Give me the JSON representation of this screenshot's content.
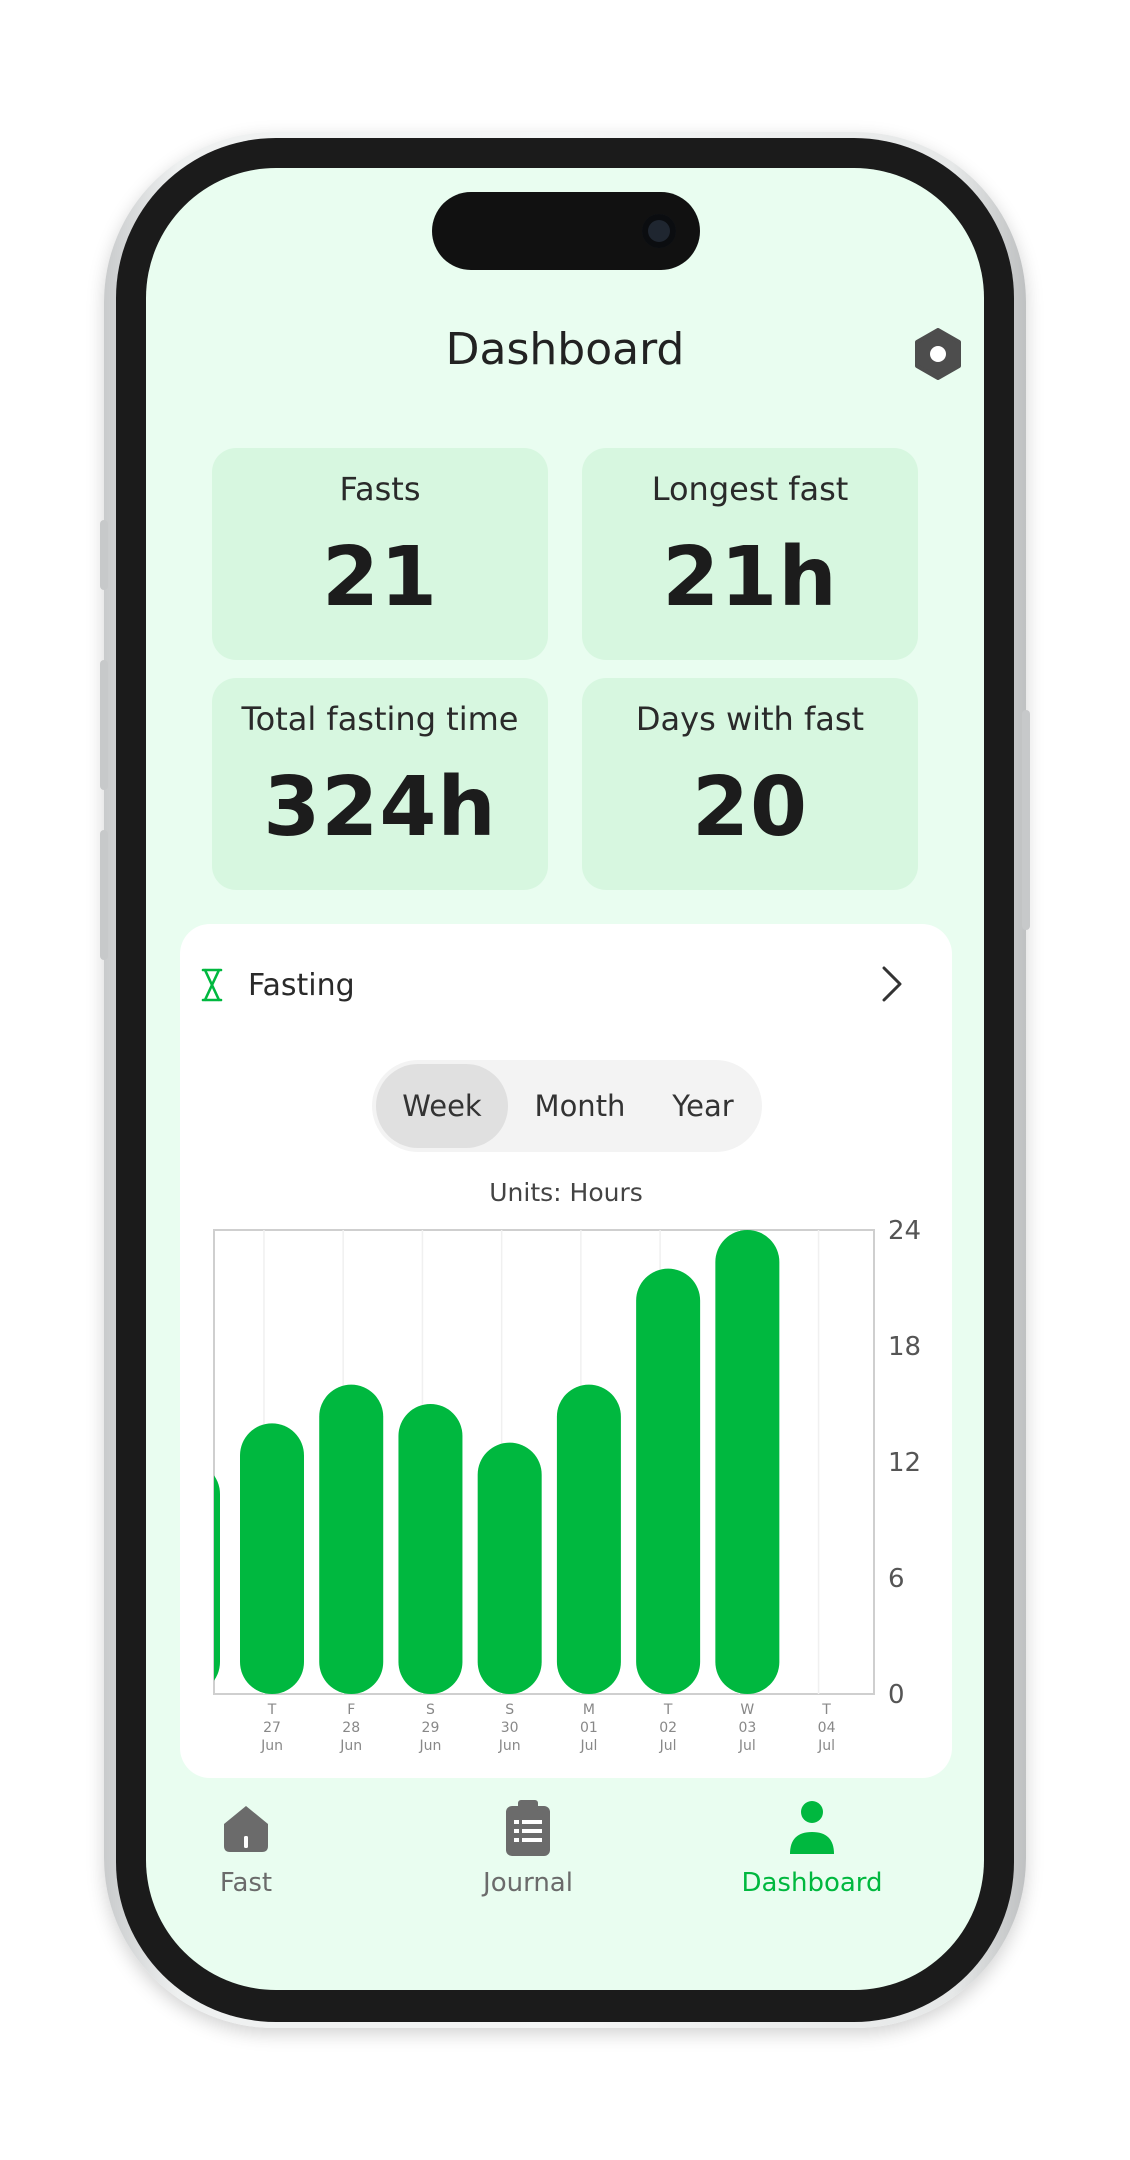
{
  "header": {
    "title": "Dashboard"
  },
  "stats": [
    {
      "label": "Fasts",
      "value": "21"
    },
    {
      "label": "Longest fast",
      "value": "21h"
    },
    {
      "label": "Total fasting time",
      "value": "324h"
    },
    {
      "label": "Days with fast",
      "value": "20"
    }
  ],
  "fasting_card": {
    "title": "Fasting",
    "tabs": [
      "Week",
      "Month",
      "Year"
    ],
    "active_tab": "Week",
    "units": "Units: Hours"
  },
  "chart_data": {
    "type": "bar",
    "categories": [
      {
        "day": "T",
        "date": "27",
        "month": "Jun"
      },
      {
        "day": "F",
        "date": "28",
        "month": "Jun"
      },
      {
        "day": "S",
        "date": "29",
        "month": "Jun"
      },
      {
        "day": "S",
        "date": "30",
        "month": "Jun"
      },
      {
        "day": "M",
        "date": "01",
        "month": "Jul"
      },
      {
        "day": "T",
        "date": "02",
        "month": "Jul"
      },
      {
        "day": "W",
        "date": "03",
        "month": "Jul"
      },
      {
        "day": "T",
        "date": "04",
        "month": "Jul"
      }
    ],
    "values": [
      14,
      16,
      15,
      13,
      16,
      22,
      24,
      0
    ],
    "partial_leading_value": 12,
    "yticks": [
      0,
      6,
      12,
      18,
      24
    ],
    "ylim": [
      0,
      24
    ],
    "color": "#00b83f"
  },
  "tabbar": [
    {
      "label": "Fast",
      "icon": "home-icon",
      "active": false
    },
    {
      "label": "Journal",
      "icon": "clipboard-icon",
      "active": false
    },
    {
      "label": "Dashboard",
      "icon": "user-icon",
      "active": true
    }
  ],
  "colors": {
    "accent": "#00b83f",
    "screen_bg": "#e9fdf0",
    "card_bg": "#d7f7e0"
  }
}
